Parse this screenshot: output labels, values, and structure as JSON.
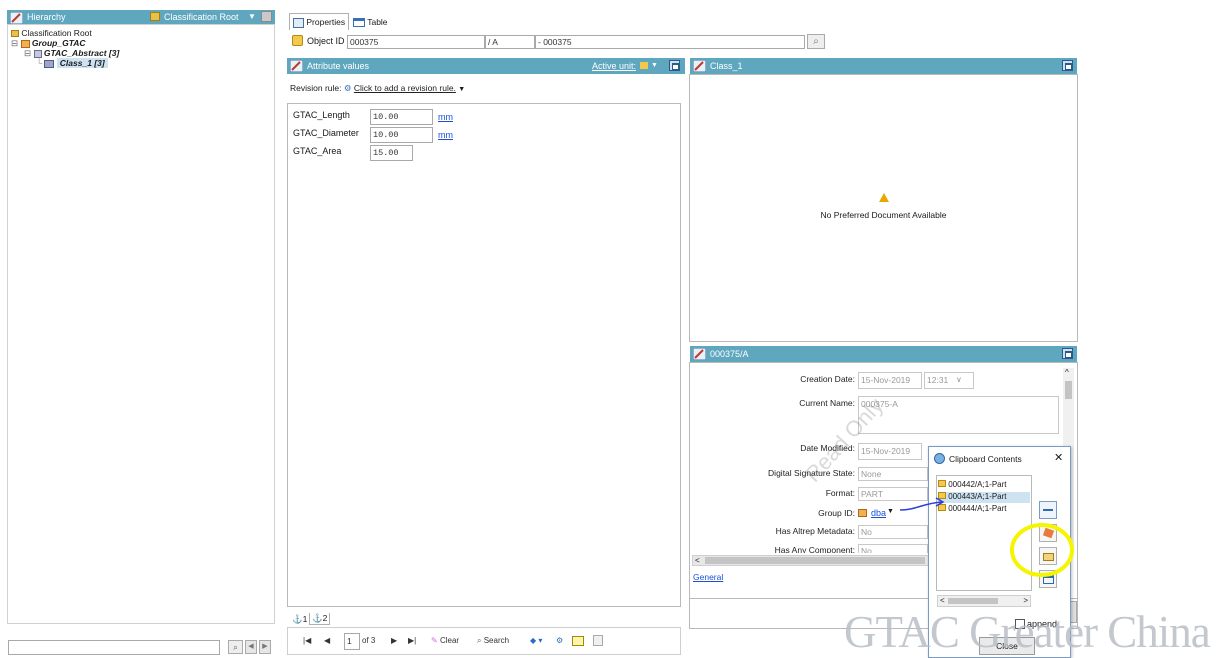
{
  "colors": {
    "header_blue": "#5fa6bf",
    "highlight_yellow": "#f5f500",
    "link_blue": "#1a4fd6"
  },
  "hierarchy": {
    "title": "Hierarchy",
    "root_label": "Classification Root",
    "tree": [
      {
        "label": "Classification Root"
      },
      {
        "label": "Group_GTAC"
      },
      {
        "label": "GTAC_Abstract  [3]"
      },
      {
        "label": "Class_1  [3]"
      }
    ]
  },
  "tabs": {
    "properties": "Properties",
    "table": "Table"
  },
  "object_id": {
    "label": "Object ID",
    "id": "000375",
    "revision": "/ A",
    "name": "- 000375"
  },
  "attributes": {
    "title": "Attribute values",
    "active_unit": "Active unit:",
    "revision_rule_label": "Revision rule:",
    "revision_rule_link": "Click to add a revision rule.",
    "rows": [
      {
        "name": "GTAC_Length",
        "value": "10.00",
        "unit": "mm"
      },
      {
        "name": "GTAC_Diameter",
        "value": "10.00",
        "unit": "mm"
      },
      {
        "name": "GTAC_Area",
        "value": "15.00",
        "unit": ""
      }
    ],
    "page_tabs": [
      "1",
      "2"
    ]
  },
  "class_panel": {
    "title": "Class_1",
    "message": "No Preferred Document Available"
  },
  "rev_panel": {
    "title": "000375/A",
    "props": [
      {
        "label": "Creation Date:",
        "value": "15-Nov-2019",
        "extra": "12:31"
      },
      {
        "label": "Current Name:",
        "value": "000375-A"
      },
      {
        "label": "Date Modified:",
        "value": "15-Nov-2019"
      },
      {
        "label": "Digital Signature State:",
        "value": "None"
      },
      {
        "label": "Format:",
        "value": "PART"
      },
      {
        "label": "Group ID:",
        "value": "dba"
      },
      {
        "label": "Has Altrep Metadata:",
        "value": "No"
      },
      {
        "label": "Has Any Component:",
        "value": "No"
      }
    ],
    "general_link": "General",
    "watermark": "Read Only"
  },
  "clipboard": {
    "title": "Clipboard Contents",
    "items": [
      "000442/A;1-Part",
      "000443/A;1-Part",
      "000444/A;1-Part"
    ],
    "append_label": "append",
    "close_label": "Close"
  },
  "bottom_toolbar": {
    "page_value": "1",
    "page_of": "of 3",
    "clear": "Clear",
    "search": "Search"
  },
  "brand_watermark": "GTAC Greater China"
}
